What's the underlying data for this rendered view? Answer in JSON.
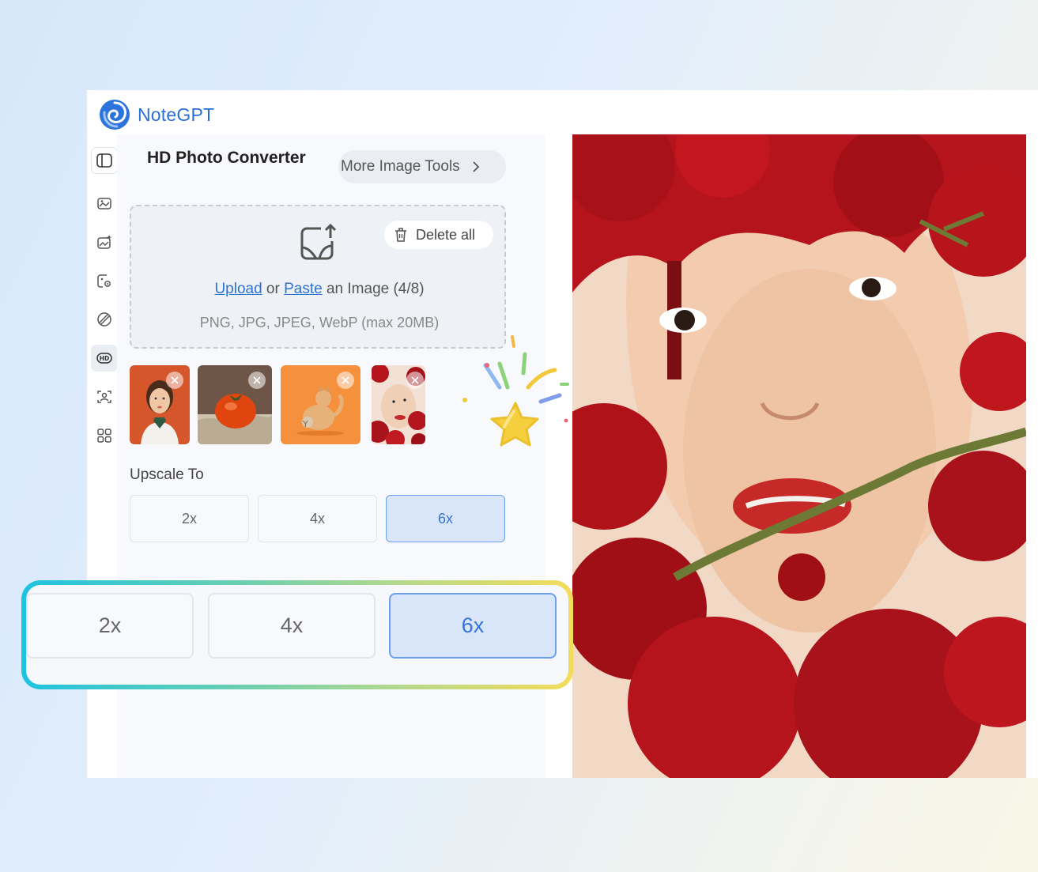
{
  "app": {
    "brand": "NoteGPT",
    "accent": "#2d72d9"
  },
  "sidebar": {
    "items": [
      {
        "icon": "panel-toggle-icon"
      },
      {
        "icon": "image-edit-icon"
      },
      {
        "icon": "image-generate-icon"
      },
      {
        "icon": "image-settings-icon"
      },
      {
        "icon": "remove-object-icon"
      },
      {
        "icon": "hd-icon",
        "active": true
      },
      {
        "icon": "face-scan-icon"
      },
      {
        "icon": "apps-grid-icon"
      }
    ]
  },
  "panel": {
    "title": "HD Photo Converter",
    "more_tools": "More Image Tools",
    "upload": {
      "delete_all": "Delete all",
      "upload_link": "Upload",
      "or": " or ",
      "paste_link": "Paste",
      "suffix": " an Image (4/8)",
      "formats": "PNG, JPG, JPEG, WebP (max 20MB)"
    },
    "thumbnails": [
      {
        "name": "girl-portrait"
      },
      {
        "name": "tomato"
      },
      {
        "name": "orange-cat"
      },
      {
        "name": "rose-portrait"
      }
    ],
    "upscale_label": "Upscale To",
    "scale_options": [
      "2x",
      "4x",
      "6x"
    ],
    "selected_scale": "6x"
  },
  "callout": {
    "options": [
      "2x",
      "4x",
      "6x"
    ],
    "selected": "6x"
  }
}
